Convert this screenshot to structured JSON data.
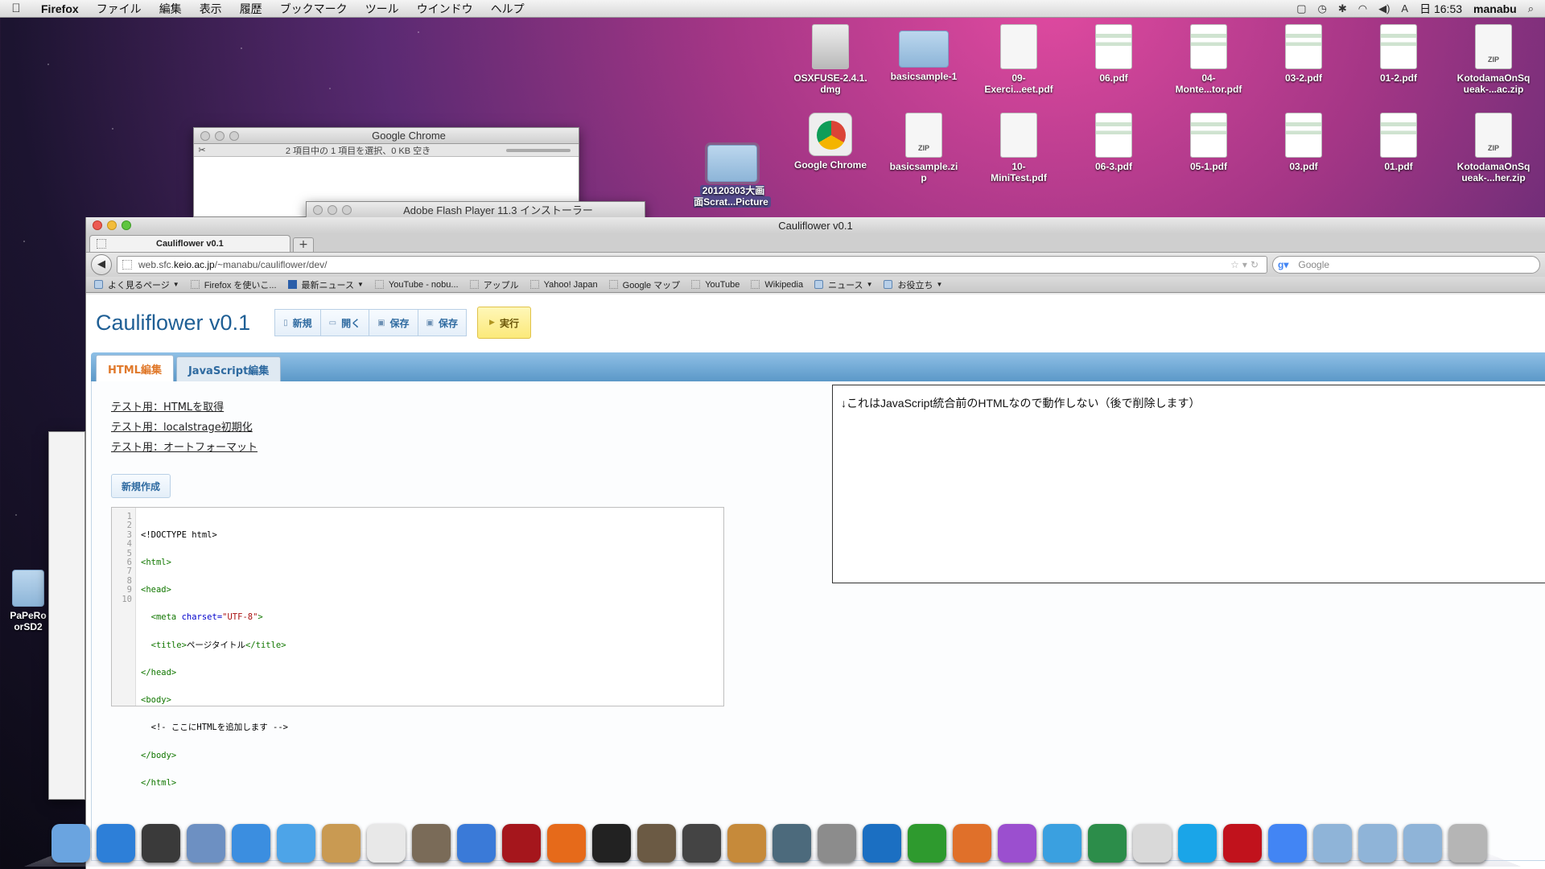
{
  "menubar": {
    "app": "Firefox",
    "menus": [
      "ファイル",
      "編集",
      "表示",
      "履歴",
      "ブックマーク",
      "ツール",
      "ウインドウ",
      "ヘルプ"
    ],
    "clock": "日 16:53",
    "user": "manabu",
    "input_indicator": "A"
  },
  "desktop": {
    "row1": [
      "OSXFUSE-2.4.1.\ndmg",
      "basicsample-1",
      "09-\nExerci...eet.pdf",
      "06.pdf",
      "04-\nMonte...tor.pdf",
      "03-2.pdf",
      "01-2.pdf",
      "KotodamaOnSq\nueak-...ac.zip"
    ],
    "row2": [
      "Google Chrome",
      "basicsample.zi\np",
      "10-\nMiniTest.pdf",
      "06-3.pdf",
      "05-1.pdf",
      "03.pdf",
      "01.pdf",
      "KotodamaOnSq\nueak-...her.zip"
    ],
    "folder_20120303": "20120303大画\n面Scrat...Picture",
    "left_item": "PaPeRo\norSD2"
  },
  "chrome_window": {
    "title": "Google Chrome",
    "status": "2 項目中の 1 項目を選択、0 KB 空き"
  },
  "flash_window": {
    "title": "Adobe Flash Player 11.3 インストーラー"
  },
  "firefox": {
    "window_title": "Cauliflower v0.1",
    "tab_title": "Cauliflower v0.1",
    "url_prefix": "web.sfc.",
    "url_domain": "keio.ac.jp",
    "url_suffix": "/~manabu/cauliflower/dev/",
    "search_placeholder": "Google",
    "bookmarks": [
      "よく見るページ",
      "Firefox を使いこ...",
      "最新ニュース",
      "YouTube - nobu...",
      "アップル",
      "Yahoo! Japan",
      "Google マップ",
      "YouTube",
      "Wikipedia",
      "ニュース",
      "お役立ち"
    ]
  },
  "app": {
    "title": "Cauliflower v0.1",
    "buttons": {
      "new": "新規",
      "open": "開く",
      "save1": "保存",
      "save2": "保存",
      "run": "実行"
    },
    "tabs": {
      "html": "HTML編集",
      "js": "JavaScript編集"
    },
    "links": [
      "テスト用：HTMLを取得",
      "テスト用：localstrage初期化",
      "テスト用：オートフォーマット"
    ],
    "new_create": "新規作成",
    "preview_note": "↓これはJavaScript統合前のHTMLなので動作しない（後で削除します）"
  },
  "editor": {
    "line_numbers": [
      "1",
      "2",
      "3",
      "4",
      "5",
      "6",
      "7",
      "8",
      "9",
      "10"
    ],
    "l1": "<!DOCTYPE html>",
    "l2": "<html>",
    "l3": "<head>",
    "l4_tag": "  <meta ",
    "l4_attr": "charset=",
    "l4_val": "\"UTF-8\"",
    "l4_end": ">",
    "l5_open": "  <title>",
    "l5_text": "ページタイトル",
    "l5_close": "</title>",
    "l6": "</head>",
    "l7": "<body>",
    "l8": "  <!- ここにHTMLを追加します -->",
    "l9": "</body>",
    "l10": "</html>"
  },
  "dock": [
    {
      "name": "finder",
      "color": "#6aa4e0"
    },
    {
      "name": "app-store",
      "color": "#2d7fd8"
    },
    {
      "name": "dashboard",
      "color": "#3a3a3a"
    },
    {
      "name": "preview",
      "color": "#6d90c2"
    },
    {
      "name": "safari",
      "color": "#3b8ee0"
    },
    {
      "name": "ichat",
      "color": "#4da4e8"
    },
    {
      "name": "address-book",
      "color": "#c99a52"
    },
    {
      "name": "ical",
      "color": "#e8e8e8"
    },
    {
      "name": "iphoto",
      "color": "#7a6b58"
    },
    {
      "name": "itunes",
      "color": "#3a7ad8"
    },
    {
      "name": "front-row",
      "color": "#a5161c"
    },
    {
      "name": "firefox",
      "color": "#e66a1a"
    },
    {
      "name": "terminal",
      "color": "#222222"
    },
    {
      "name": "image-capture",
      "color": "#6b5a44"
    },
    {
      "name": "imovie",
      "color": "#444444"
    },
    {
      "name": "garageband",
      "color": "#c68a3a"
    },
    {
      "name": "time-machine",
      "color": "#4c6a7c"
    },
    {
      "name": "system-preferences",
      "color": "#8c8c8c"
    },
    {
      "name": "word",
      "color": "#1b6fc2"
    },
    {
      "name": "excel",
      "color": "#2e9a2e"
    },
    {
      "name": "powerpoint",
      "color": "#e0702a"
    },
    {
      "name": "entourage",
      "color": "#9b4fcf"
    },
    {
      "name": "messenger",
      "color": "#3aa0e0"
    },
    {
      "name": "downloader",
      "color": "#2c8d4a"
    },
    {
      "name": "activity",
      "color": "#d9d9d9"
    },
    {
      "name": "skype",
      "color": "#1aa5e8"
    },
    {
      "name": "flash",
      "color": "#c1121c"
    },
    {
      "name": "chrome",
      "color": "#4285f4"
    },
    {
      "name": "applications-stack",
      "color": "#8fb4d8"
    },
    {
      "name": "documents-stack",
      "color": "#8fb4d8"
    },
    {
      "name": "downloads-stack",
      "color": "#8fb4d8"
    },
    {
      "name": "trash",
      "color": "#b5b5b5"
    }
  ]
}
